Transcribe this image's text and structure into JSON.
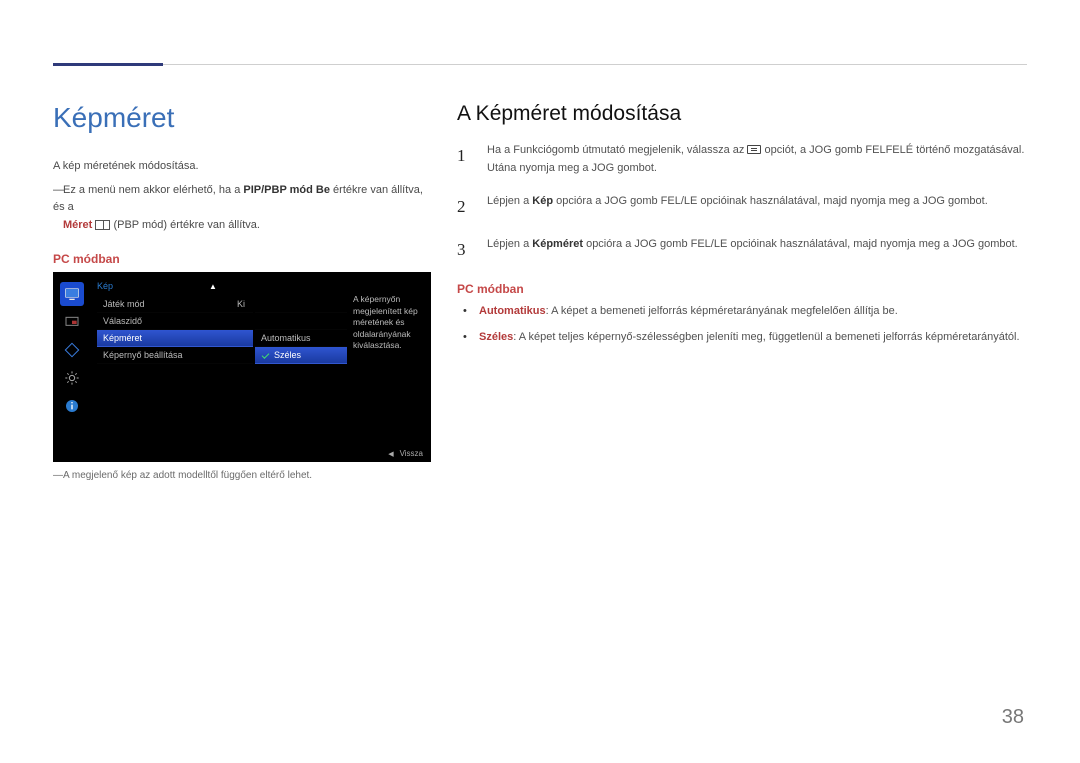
{
  "page_number": "38",
  "left": {
    "title": "Képméret",
    "line1": "A kép méretének módosítása.",
    "note_prefix": "Ez a menü nem akkor elérhető, ha a ",
    "note_bold": "PIP/PBP mód Be",
    "note_mid": " értékre van állítva, és a ",
    "note_red": "Méret",
    "note_suffix": " (PBP mód) értékre van állítva.",
    "sub_heading": "PC módban",
    "osd": {
      "header": "Kép",
      "rows": [
        {
          "label": "Játék mód",
          "value": "Ki"
        },
        {
          "label": "Válaszidő",
          "value": ""
        },
        {
          "label": "Képméret",
          "value": ""
        },
        {
          "label": "Képernyő beállítása",
          "value": ""
        }
      ],
      "selected_row_index": 2,
      "options": [
        {
          "label": "Automatikus",
          "checked": false
        },
        {
          "label": "Széles",
          "checked": true
        }
      ],
      "selected_option_index": 1,
      "desc": "A képernyőn megjelenített kép méretének és oldalarányának kiválasztása.",
      "back_label": "Vissza"
    },
    "footnote": "A megjelenő kép az adott modelltől függően eltérő lehet."
  },
  "right": {
    "title": "A Képméret módosítása",
    "steps": [
      {
        "n": "1",
        "pre": "Ha a Funkciógomb útmutató megjelenik, válassza az ",
        "post": " opciót, a JOG gomb FELFELÉ történő mozgatásával. Utána nyomja meg a JOG gombot."
      },
      {
        "n": "2",
        "pre": "Lépjen a ",
        "bold": "Kép",
        "post": " opcióra a JOG gomb FEL/LE opcióinak használatával, majd nyomja meg a JOG gombot."
      },
      {
        "n": "3",
        "pre": "Lépjen a ",
        "bold": "Képméret",
        "post": " opcióra a JOG gomb FEL/LE opcióinak használatával, majd nyomja meg a JOG gombot."
      }
    ],
    "sub_heading": "PC módban",
    "bullets": [
      {
        "term": "Automatikus",
        "text": ": A képet a bemeneti jelforrás képméretarányának megfelelően állítja be."
      },
      {
        "term": "Széles",
        "text": ": A képet teljes képernyő-szélességben jeleníti meg, függetlenül a bemeneti jelforrás képméretarányától."
      }
    ]
  }
}
